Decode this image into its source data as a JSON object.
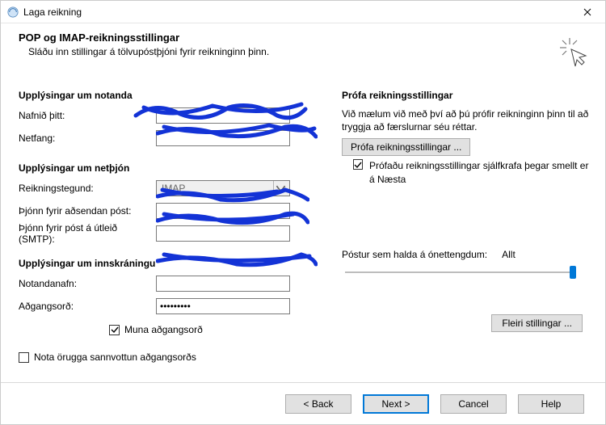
{
  "window": {
    "title": "Laga reikning"
  },
  "header": {
    "title": "POP og IMAP-reikningsstillingar",
    "subtitle": "Sláðu inn stillingar á tölvupóstþjóni fyrir reikninginn þinn."
  },
  "sections": {
    "user": {
      "title": "Upplýsingar um notanda",
      "name_label": "Nafnið þitt:",
      "name_value": "",
      "email_label": "Netfang:",
      "email_value": ""
    },
    "server": {
      "title": "Upplýsingar um netþjón",
      "type_label": "Reikningstegund:",
      "type_value": "IMAP",
      "incoming_label": "Þjónn fyrir aðsendan póst:",
      "incoming_value": "",
      "outgoing_label": "Þjónn fyrir póst á útleið (SMTP):",
      "outgoing_value": ""
    },
    "logon": {
      "title": "Upplýsingar um innskráningu",
      "user_label": "Notandanafn:",
      "user_value": "",
      "pass_label": "Aðgangsorð:",
      "pass_value": "•••••••••",
      "remember": "Muna aðgangsorð",
      "spa": "Nota örugga sannvottun aðgangsorðs"
    }
  },
  "test": {
    "title": "Prófa reikningsstillingar",
    "desc": "Við mælum við með því að þú prófir reikninginn þinn til að tryggja að færslurnar séu réttar.",
    "button": "Prófa reikningsstillingar ...",
    "auto": "Prófaðu reikningsstillingar sjálfkrafa þegar smellt er á Næsta"
  },
  "offline": {
    "label": "Póstur sem halda á ónettengdum:",
    "value": "Allt"
  },
  "more_button": "Fleiri stillingar ...",
  "footer": {
    "back": "<  Back",
    "next": "Next  >",
    "cancel": "Cancel",
    "help": "Help"
  }
}
